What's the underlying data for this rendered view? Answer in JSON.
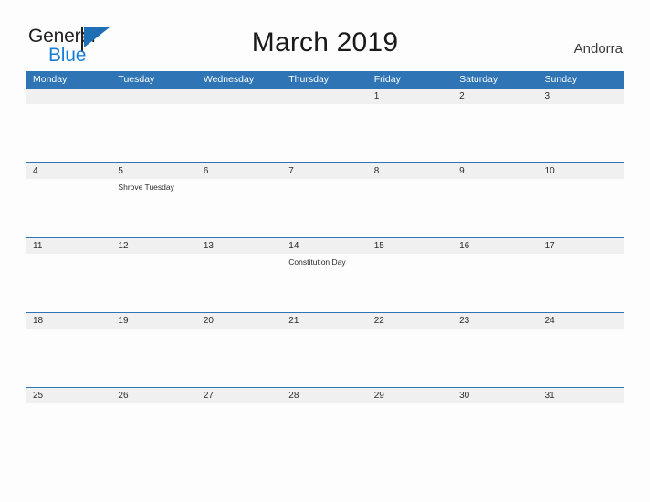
{
  "brand": {
    "name_part1": "General",
    "name_part2": "Blue",
    "flag_icon": "flag-triangle-icon",
    "accent_color": "#1b7fd4"
  },
  "header": {
    "title": "March 2019",
    "country": "Andorra"
  },
  "theme": {
    "header_blue": "#2f74b5",
    "date_band_gray": "#f0f0f0",
    "page_background": "#fdfdfd",
    "text_color": "#2b2b2b"
  },
  "calendar": {
    "weekdays": [
      "Monday",
      "Tuesday",
      "Wednesday",
      "Thursday",
      "Friday",
      "Saturday",
      "Sunday"
    ],
    "weeks": [
      {
        "dates": [
          "",
          "",
          "",
          "",
          "1",
          "2",
          "3"
        ],
        "events": [
          "",
          "",
          "",
          "",
          "",
          "",
          ""
        ]
      },
      {
        "dates": [
          "4",
          "5",
          "6",
          "7",
          "8",
          "9",
          "10"
        ],
        "events": [
          "",
          "Shrove Tuesday",
          "",
          "",
          "",
          "",
          ""
        ]
      },
      {
        "dates": [
          "11",
          "12",
          "13",
          "14",
          "15",
          "16",
          "17"
        ],
        "events": [
          "",
          "",
          "",
          "Constitution Day",
          "",
          "",
          ""
        ]
      },
      {
        "dates": [
          "18",
          "19",
          "20",
          "21",
          "22",
          "23",
          "24"
        ],
        "events": [
          "",
          "",
          "",
          "",
          "",
          "",
          ""
        ]
      },
      {
        "dates": [
          "25",
          "26",
          "27",
          "28",
          "29",
          "30",
          "31"
        ],
        "events": [
          "",
          "",
          "",
          "",
          "",
          "",
          ""
        ]
      }
    ]
  }
}
